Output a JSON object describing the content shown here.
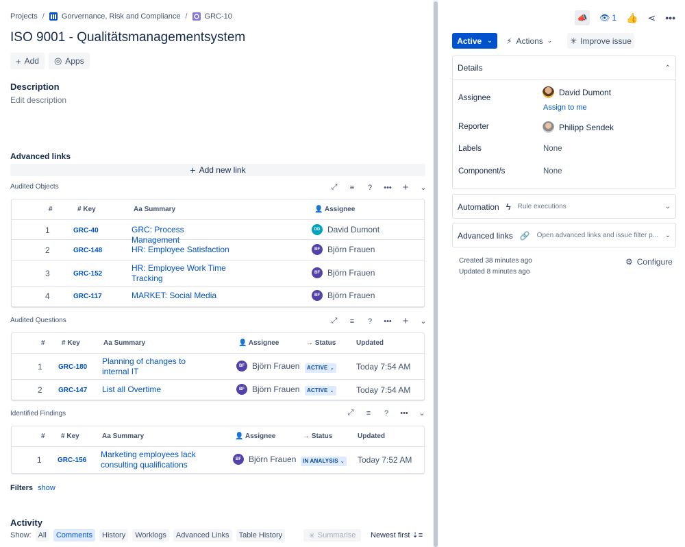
{
  "breadcrumb": {
    "projects": "Projects",
    "project": "Gorvernance, Risk and Compliance",
    "issue_key": "GRC-10"
  },
  "issue": {
    "title": "ISO 9001 - Qualitätsmanagementsystem",
    "add_label": "Add",
    "apps_label": "Apps"
  },
  "description": {
    "heading": "Description",
    "placeholder": "Edit description"
  },
  "advanced_links": {
    "heading": "Advanced links",
    "add_new_link": "Add new link"
  },
  "sections": {
    "audited_objects": {
      "title": "Audited Objects",
      "columns": {
        "num": "#",
        "key": "Key",
        "summary": "Summary",
        "assignee": "Assignee"
      },
      "rows": [
        {
          "num": "1",
          "key": "GRC-40",
          "summary": "GRC: Process Management",
          "assignee": "David Dumont",
          "initials": "DD"
        },
        {
          "num": "2",
          "key": "GRC-148",
          "summary": "HR: Employee Satisfaction",
          "assignee": "Björn Frauen",
          "initials": "BF"
        },
        {
          "num": "3",
          "key": "GRC-152",
          "summary": "HR: Employee Work Time Tracking",
          "assignee": "Björn Frauen",
          "initials": "BF"
        },
        {
          "num": "4",
          "key": "GRC-117",
          "summary": "MARKET: Social Media",
          "assignee": "Björn Frauen",
          "initials": "BF"
        }
      ]
    },
    "audited_questions": {
      "title": "Audited Questions",
      "columns": {
        "num": "#",
        "key": "Key",
        "summary": "Summary",
        "assignee": "Assignee",
        "status": "Status",
        "updated": "Updated"
      },
      "rows": [
        {
          "num": "1",
          "key": "GRC-180",
          "summary": "Planning of changes to internal IT",
          "assignee": "Björn Frauen",
          "initials": "BF",
          "status": "ACTIVE",
          "updated": "Today 7:54 AM"
        },
        {
          "num": "2",
          "key": "GRC-147",
          "summary": "List all Overtime",
          "assignee": "Björn Frauen",
          "initials": "BF",
          "status": "ACTIVE",
          "updated": "Today 7:54 AM"
        }
      ]
    },
    "identified_findings": {
      "title": "Identified Findings",
      "columns": {
        "num": "#",
        "key": "Key",
        "summary": "Summary",
        "assignee": "Assignee",
        "status": "Status",
        "updated": "Updated"
      },
      "rows": [
        {
          "num": "1",
          "key": "GRC-156",
          "summary": "Marketing employees lack consulting qualifications",
          "assignee": "Björn Frauen",
          "initials": "BF",
          "status": "IN ANALYSIS",
          "updated": "Today 7:52 AM"
        }
      ]
    }
  },
  "filters": {
    "label": "Filters",
    "link": "show"
  },
  "activity": {
    "heading": "Activity",
    "show_label": "Show:",
    "chips": [
      "All",
      "Comments",
      "History",
      "Worklogs",
      "Advanced Links",
      "Table History"
    ],
    "selected": "Comments",
    "summarise": "Summarise",
    "sort": "Newest first"
  },
  "right": {
    "watch_count": "1",
    "status": "Active",
    "actions": "Actions",
    "improve": "Improve issue",
    "details": {
      "heading": "Details",
      "assignee_label": "Assignee",
      "assignee": "David Dumont",
      "assign_to_me": "Assign to me",
      "reporter_label": "Reporter",
      "reporter": "Philipp Sendek",
      "labels_label": "Labels",
      "labels": "None",
      "components_label": "Component/s",
      "components": "None"
    },
    "automation": {
      "heading": "Automation",
      "sub": "Rule executions"
    },
    "adv_links": {
      "heading": "Advanced links",
      "sub": "Open advanced links and issue filter p..."
    },
    "created": "Created 38 minutes ago",
    "updated": "Updated 8 minutes ago",
    "configure": "Configure"
  },
  "colors": {
    "primary": "#0052cc",
    "lozenge_bg": "#deebff",
    "avatar_bf": "#5243aa",
    "avatar_dd": "#00a3bf"
  }
}
